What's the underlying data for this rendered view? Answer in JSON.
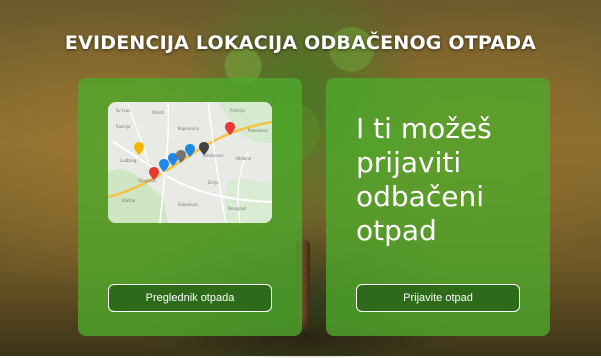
{
  "header": {
    "title": "EVIDENCIJA LOKACIJA ODBAČENOG OTPADA"
  },
  "left_card": {
    "button_label": "Preglednik otpada",
    "map_pins": [
      {
        "color": "#f2b705",
        "icon": "map-pin-icon"
      },
      {
        "color": "#e53935",
        "icon": "map-pin-icon"
      },
      {
        "color": "#1e88e5",
        "icon": "map-pin-icon"
      },
      {
        "color": "#1e88e5",
        "icon": "map-pin-icon"
      },
      {
        "color": "#757575",
        "icon": "map-pin-icon"
      },
      {
        "color": "#1e88e5",
        "icon": "map-pin-icon"
      },
      {
        "color": "#424242",
        "icon": "map-pin-icon"
      },
      {
        "color": "#e53935",
        "icon": "map-pin-icon"
      }
    ]
  },
  "right_card": {
    "lines": [
      "I ti možeš",
      "prijaviti",
      "odbačeni",
      "otpad"
    ],
    "button_label": "Prijavite otpad"
  },
  "colors": {
    "card_bg": "#4eaa2c",
    "button_bg": "#2d6b1a",
    "text": "#ffffff"
  }
}
